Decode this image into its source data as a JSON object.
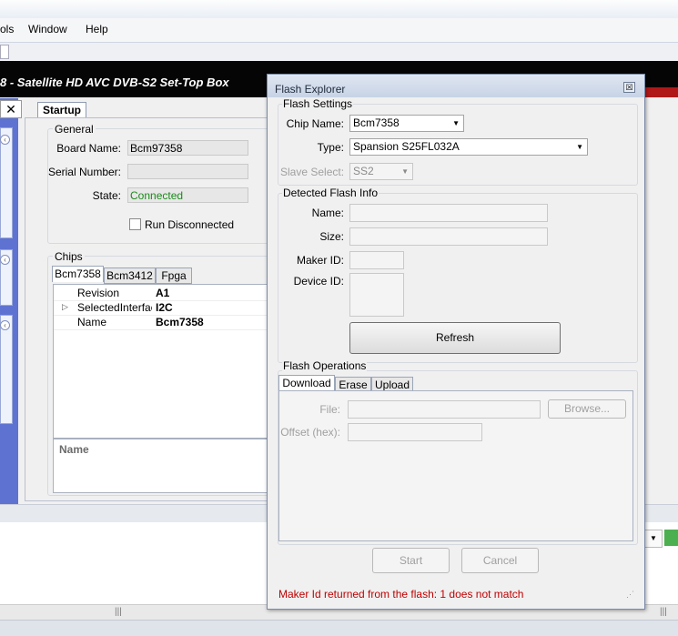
{
  "menubar": {
    "items": [
      "ols",
      "Window",
      "Help"
    ]
  },
  "app": {
    "title": "8 - Satellite HD AVC DVB-S2 Set-Top Box"
  },
  "startup": {
    "tab_label": "Startup",
    "general": {
      "label": "General",
      "board_name_label": "Board Name:",
      "board_name_value": "Bcm97358",
      "serial_number_label": "Serial Number:",
      "serial_number_value": "",
      "state_label": "State:",
      "state_value": "Connected",
      "run_disconnected_label": "Run Disconnected"
    },
    "chips": {
      "label": "Chips",
      "tabs": [
        "Bcm7358",
        "Bcm3412",
        "Fpga"
      ],
      "properties": [
        {
          "name": "Revision",
          "value": "A1"
        },
        {
          "name": "SelectedInterface",
          "value": "I2C"
        },
        {
          "name": "Name",
          "value": "Bcm7358"
        }
      ],
      "description_title": "Name"
    }
  },
  "flash_explorer": {
    "title": "Flash Explorer",
    "close_glyph": "☒",
    "settings": {
      "label": "Flash Settings",
      "chip_name_label": "Chip Name:",
      "chip_name_value": "Bcm7358",
      "type_label": "Type:",
      "type_value": "Spansion S25FL032A",
      "slave_select_label": "Slave Select:",
      "slave_select_value": "SS2"
    },
    "detected": {
      "label": "Detected Flash Info",
      "name_label": "Name:",
      "name_value": "",
      "size_label": "Size:",
      "size_value": "",
      "maker_id_label": "Maker ID:",
      "maker_id_value": "",
      "device_id_label": "Device ID:",
      "device_id_value": "",
      "refresh_label": "Refresh"
    },
    "operations": {
      "label": "Flash Operations",
      "tabs": [
        "Download",
        "Erase",
        "Upload"
      ],
      "file_label": "File:",
      "file_value": "",
      "browse_label": "Browse...",
      "offset_label": "Offset (hex):",
      "offset_value": "",
      "start_label": "Start",
      "cancel_label": "Cancel"
    },
    "status_message": "Maker Id returned from the flash: 1 does not match"
  }
}
